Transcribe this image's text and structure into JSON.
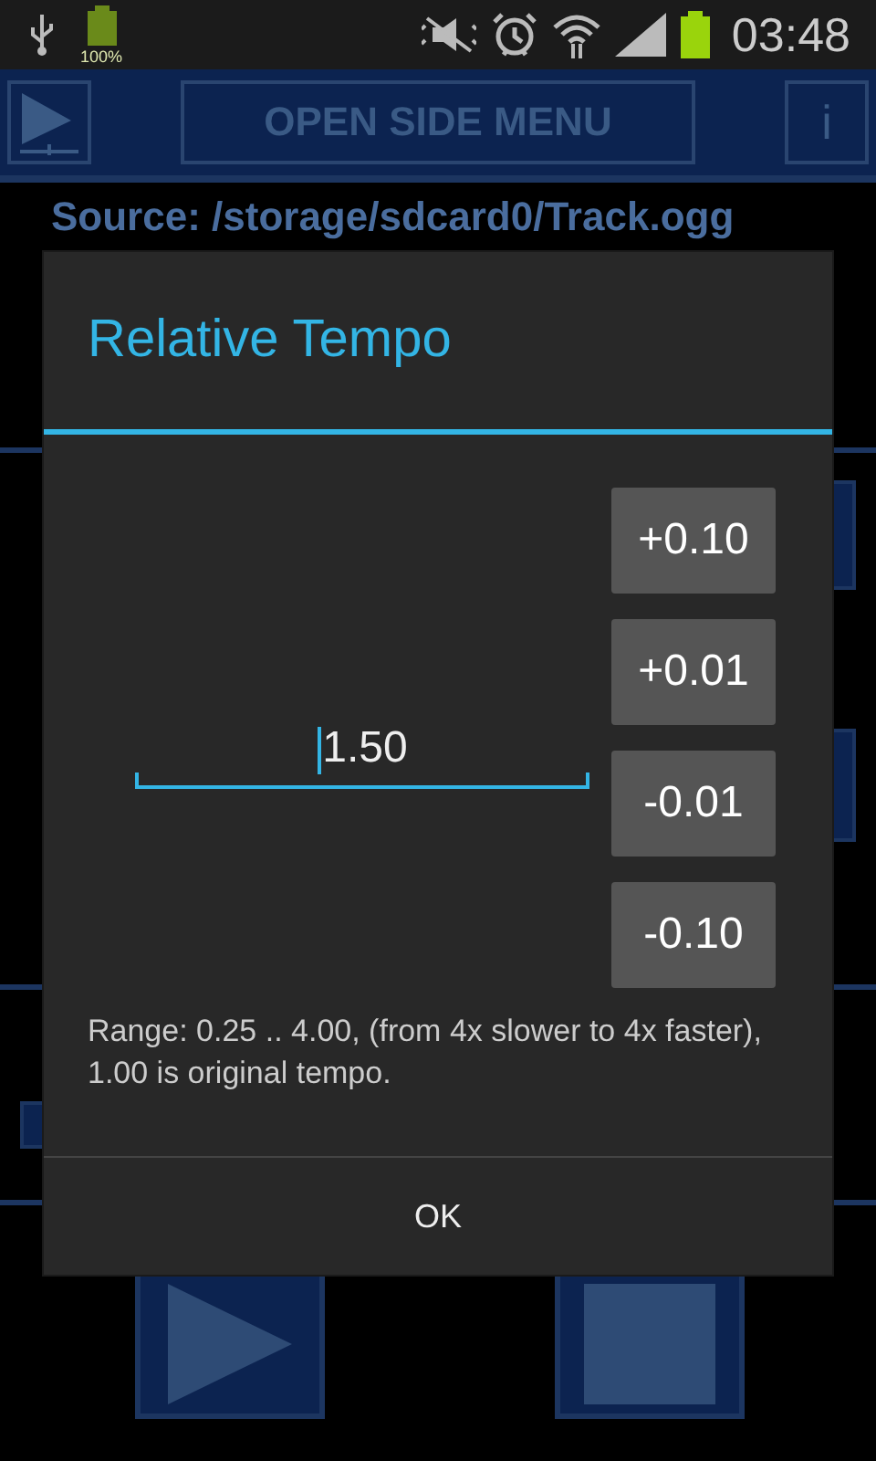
{
  "status_bar": {
    "battery_label": "100%",
    "time": "03:48"
  },
  "toolbar": {
    "menu_button": "OPEN SIDE MENU",
    "info_button": "i"
  },
  "source": "Source: /storage/sdcard0/Track.ogg",
  "dialog": {
    "title": "Relative Tempo",
    "value": "1.50",
    "steps": [
      "+0.10",
      "+0.01",
      "-0.01",
      "-0.10"
    ],
    "note": "Range: 0.25 .. 4.00, (from 4x slower to 4x faster), 1.00 is original tempo.",
    "ok": "OK"
  }
}
